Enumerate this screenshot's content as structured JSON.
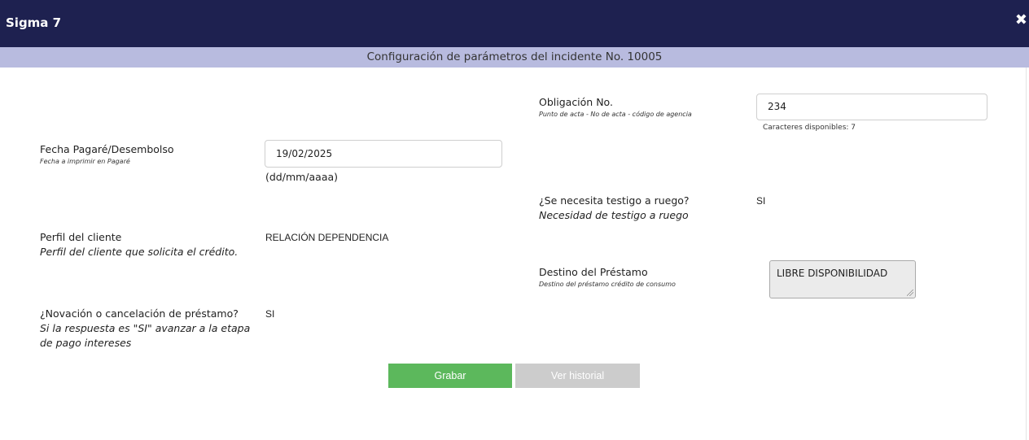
{
  "window": {
    "title": "Sigma 7",
    "close_glyph": "✖"
  },
  "header": {
    "text": "Configuración de parámetros del incidente No. 10005"
  },
  "fields": {
    "obligacion": {
      "label": "Obligación No.",
      "hint": "Punto de acta - No de acta - código de agencia",
      "value": "234",
      "chars_available": "Caracteres disponibles: 7"
    },
    "fecha_pagare": {
      "label": "Fecha Pagaré/Desembolso",
      "hint": "Fecha a imprimir en Pagaré",
      "value": "19/02/2025",
      "format": "(dd/mm/aaaa)"
    },
    "testigo": {
      "label": "¿Se necesita testigo a ruego?",
      "hint": "Necesidad de testigo a ruego",
      "value": "SI"
    },
    "perfil": {
      "label": "Perfil del cliente",
      "hint": "Perfil del cliente que solicita el crédito.",
      "value": "RELACIÓN DEPENDENCIA"
    },
    "destino": {
      "label": "Destino del Préstamo",
      "hint": "Destino del préstamo crédito de consumo",
      "value": "LIBRE DISPONIBILIDAD"
    },
    "novacion": {
      "label": "¿Novación o cancelación de préstamo?",
      "hint_line1": "Si la respuesta es \"SI\" avanzar a la etapa",
      "hint_line2": "de pago intereses",
      "value": "SI"
    }
  },
  "actions": {
    "save_label": "Grabar",
    "history_label": "Ver historial"
  },
  "colors": {
    "titlebar": "#1e2150",
    "subheader": "#b8bbdf",
    "save": "#5cb85c",
    "history": "#cccccc"
  }
}
